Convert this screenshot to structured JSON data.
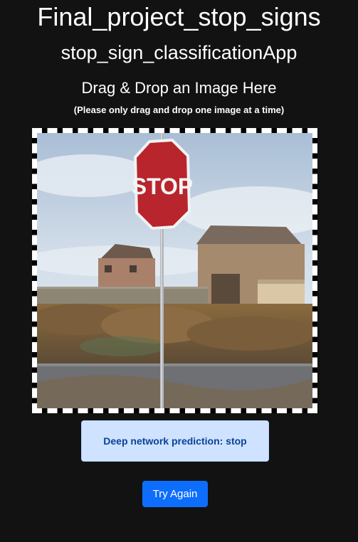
{
  "header": {
    "title": "Final_project_stop_signs",
    "subtitle": "stop_sign_classificationApp"
  },
  "upload": {
    "heading": "Drag & Drop an Image Here",
    "note": "(Please only drag and drop one image at a time)",
    "sign_text": "STOP"
  },
  "result": {
    "prediction": "Deep network prediction: stop"
  },
  "actions": {
    "try_again_label": "Try Again"
  },
  "colors": {
    "background": "#121212",
    "alert_bg": "#cfe2ff",
    "alert_text": "#084298",
    "primary_button": "#0d6efd"
  }
}
